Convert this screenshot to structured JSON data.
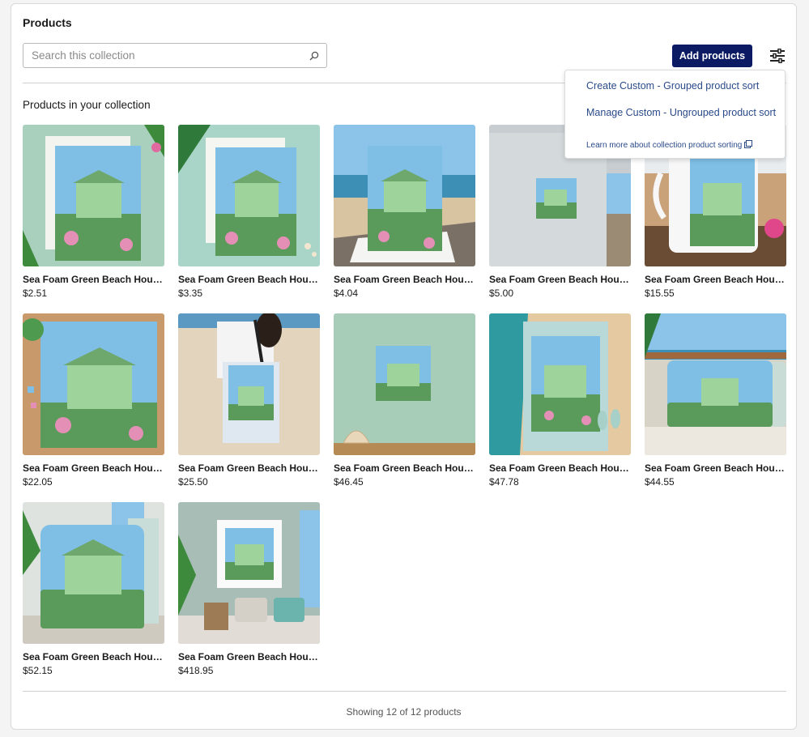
{
  "header": {
    "title": "Products"
  },
  "search": {
    "placeholder": "Search this collection",
    "value": "",
    "icon": "search-icon"
  },
  "toolbar": {
    "add_label": "Add products",
    "sort_icon": "sort-settings-icon"
  },
  "collection": {
    "heading": "Products in your collection"
  },
  "sort_menu": {
    "items": [
      "Create Custom - Grouped product sort",
      "Manage Custom - Ungrouped product sort"
    ],
    "learn_more": "Learn more about collection product sorting",
    "learn_more_icon": "external-link-icon"
  },
  "products": [
    {
      "name": "Sea Foam Green Beach House...",
      "price": "$2.51"
    },
    {
      "name": "Sea Foam Green Beach House...",
      "price": "$3.35"
    },
    {
      "name": "Sea Foam Green Beach House...",
      "price": "$4.04"
    },
    {
      "name": "Sea Foam Green Beach House...",
      "price": "$5.00"
    },
    {
      "name": "Sea Foam Green Beach House...",
      "price": "$15.55"
    },
    {
      "name": "Sea Foam Green Beach House...",
      "price": "$22.05"
    },
    {
      "name": "Sea Foam Green Beach House...",
      "price": "$25.50"
    },
    {
      "name": "Sea Foam Green Beach House...",
      "price": "$46.45"
    },
    {
      "name": "Sea Foam Green Beach House...",
      "price": "$47.78"
    },
    {
      "name": "Sea Foam Green Beach House...",
      "price": "$44.55"
    },
    {
      "name": "Sea Foam Green Beach House...",
      "price": "$52.15"
    },
    {
      "name": "Sea Foam Green Beach House...",
      "price": "$418.95"
    }
  ],
  "footer": {
    "status": "Showing 12 of 12 products"
  },
  "colors": {
    "primary_button": "#0b1a63",
    "link": "#2a4a8a"
  }
}
